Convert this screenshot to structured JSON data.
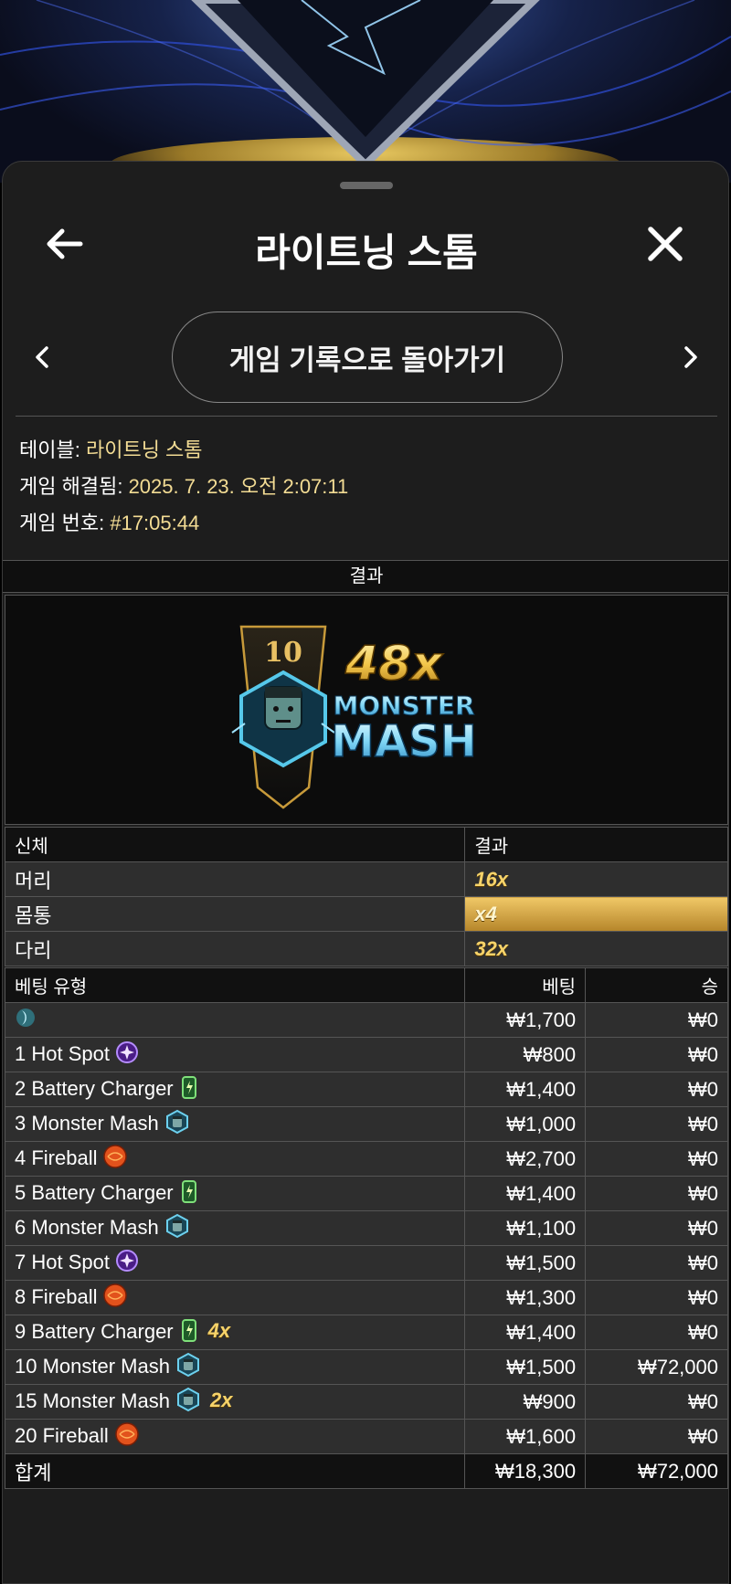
{
  "header": {
    "title": "라이트닝 스톰"
  },
  "nav": {
    "back_to_history": "게임 기록으로 돌아가기"
  },
  "info": {
    "table_label": "테이블:",
    "table_value": "라이트닝 스톰",
    "resolved_label": "게임 해결됨:",
    "resolved_value": "2025. 7. 23. 오전 2:07:11",
    "game_no_label": "게임 번호:",
    "game_no_value": "#17:05:44"
  },
  "result": {
    "header": "결과",
    "segment_number": "10",
    "multiplier": "48x",
    "name_line1": "MONSTER",
    "name_line2": "MASH"
  },
  "body_table": {
    "col_part": "신체",
    "col_result": "결과",
    "rows": [
      {
        "part": "머리",
        "result": "16x",
        "highlight": false
      },
      {
        "part": "몸통",
        "result": "x4",
        "highlight": true
      },
      {
        "part": "다리",
        "result": "32x",
        "highlight": false
      }
    ]
  },
  "bet_table": {
    "col_type": "베팅 유형",
    "col_bet": "베팅",
    "col_win": "승",
    "rows": [
      {
        "label": "",
        "icon": "moon-icon",
        "extra": "",
        "bet": "₩1,700",
        "win": "₩0"
      },
      {
        "label": "1 Hot Spot",
        "icon": "hot-spot-icon",
        "extra": "",
        "bet": "₩800",
        "win": "₩0"
      },
      {
        "label": "2 Battery Charger",
        "icon": "battery-icon",
        "extra": "",
        "bet": "₩1,400",
        "win": "₩0"
      },
      {
        "label": "3 Monster Mash",
        "icon": "monster-icon",
        "extra": "",
        "bet": "₩1,000",
        "win": "₩0"
      },
      {
        "label": "4 Fireball",
        "icon": "fireball-icon",
        "extra": "",
        "bet": "₩2,700",
        "win": "₩0"
      },
      {
        "label": "5 Battery Charger",
        "icon": "battery-icon",
        "extra": "",
        "bet": "₩1,400",
        "win": "₩0"
      },
      {
        "label": "6 Monster Mash",
        "icon": "monster-icon",
        "extra": "",
        "bet": "₩1,100",
        "win": "₩0"
      },
      {
        "label": "7 Hot Spot",
        "icon": "hot-spot-icon",
        "extra": "",
        "bet": "₩1,500",
        "win": "₩0"
      },
      {
        "label": "8 Fireball",
        "icon": "fireball-icon",
        "extra": "",
        "bet": "₩1,300",
        "win": "₩0"
      },
      {
        "label": "9 Battery Charger",
        "icon": "battery-icon",
        "extra": "4x",
        "bet": "₩1,400",
        "win": "₩0"
      },
      {
        "label": "10 Monster Mash",
        "icon": "monster-icon",
        "extra": "",
        "bet": "₩1,500",
        "win": "₩72,000"
      },
      {
        "label": "15 Monster Mash",
        "icon": "monster-icon",
        "extra": "2x",
        "bet": "₩900",
        "win": "₩0"
      },
      {
        "label": "20 Fireball",
        "icon": "fireball-icon",
        "extra": "",
        "bet": "₩1,600",
        "win": "₩0"
      }
    ],
    "total_label": "합계",
    "total_bet": "₩18,300",
    "total_win": "₩72,000"
  }
}
